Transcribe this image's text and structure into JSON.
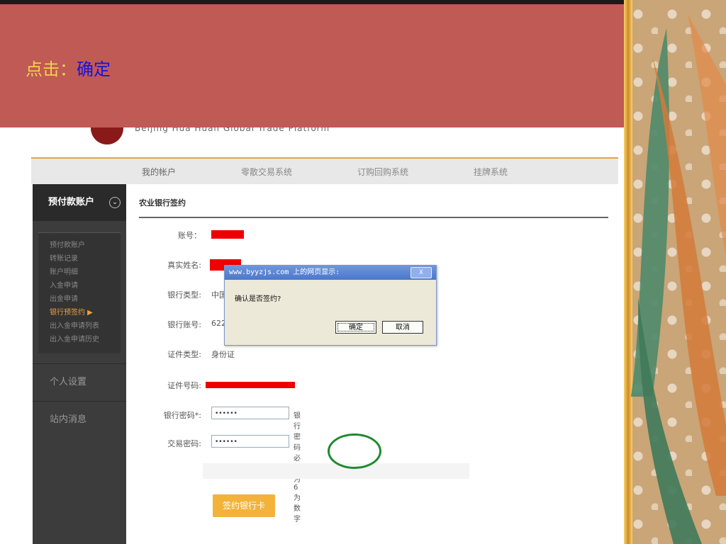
{
  "slide": {
    "caption_prefix": "点击：",
    "caption_action": "确定"
  },
  "site": {
    "logo_text": "Beijing Hua Huan Global Trade Platform"
  },
  "topnav": {
    "tabs": [
      "我的帐户",
      "零散交易系统",
      "订购回购系统",
      "挂牌系统"
    ]
  },
  "sidebar": {
    "header": "预付款账户",
    "header_icon": "chevron-circle-icon",
    "items": [
      "预付款账户",
      "转账记录",
      "账户明细",
      "入金申请",
      "出金申请",
      "银行预签约 ▶",
      "出入金申请列表",
      "出入金申请历史"
    ],
    "sections": [
      "个人设置",
      "站内消息"
    ]
  },
  "form": {
    "title": "农业银行签约",
    "account_label": "账号：",
    "real_name_label": "真实姓名:",
    "bank_type_label": "银行类型:",
    "bank_type_value": "中国",
    "bank_account_label": "银行账号:",
    "bank_account_value": "622",
    "id_type_label": "证件类型:",
    "id_type_value": "身份证",
    "id_number_label": "证件号码:",
    "bank_password_label": "银行密码*:",
    "bank_password_value": "••••••",
    "bank_password_hint": "银行密码必须为6为数字",
    "trade_password_label": "交易密码:",
    "trade_password_value": "••••••",
    "submit_label": "签约银行卡"
  },
  "dialog": {
    "title": "www.byyzjs.com 上的网页显示:",
    "message": "确认是否签约?",
    "ok_label": "确定",
    "cancel_label": "取消",
    "close_label": "X"
  },
  "colors": {
    "slide_band": "#c05a55",
    "caption_text": "#f2d24a",
    "caption_highlight": "#1414e0",
    "accent_orange": "#e9a23b",
    "redaction": "#e00000",
    "highlight_ring": "#1f8a2e"
  }
}
